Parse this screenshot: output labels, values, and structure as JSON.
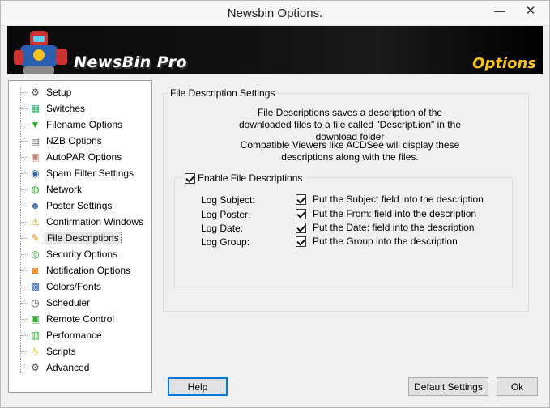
{
  "window": {
    "title": "Newsbin Options.",
    "minimize_glyph": "—",
    "close_glyph": "✕"
  },
  "banner": {
    "brand": "NewsBin Pro",
    "tag": "Options"
  },
  "sidebar": {
    "items": [
      {
        "label": "Setup",
        "icon": "gear-icon",
        "glyph": "⚙",
        "color": "#555"
      },
      {
        "label": "Switches",
        "icon": "switches-icon",
        "glyph": "▦",
        "color": "#2a6"
      },
      {
        "label": "Filename Options",
        "icon": "download-icon",
        "glyph": "▼",
        "color": "#2a2"
      },
      {
        "label": "NZB Options",
        "icon": "nzb-icon",
        "glyph": "▤",
        "color": "#666"
      },
      {
        "label": "AutoPAR Options",
        "icon": "autopar-icon",
        "glyph": "▣",
        "color": "#b87"
      },
      {
        "label": "Spam Filter Settings",
        "icon": "spam-filter-icon",
        "glyph": "◉",
        "color": "#369"
      },
      {
        "label": "Network",
        "icon": "network-icon",
        "glyph": "◍",
        "color": "#3a3"
      },
      {
        "label": "Poster Settings",
        "icon": "poster-icon",
        "glyph": "☻",
        "color": "#46a"
      },
      {
        "label": "Confirmation Windows",
        "icon": "warning-icon",
        "glyph": "⚠",
        "color": "#d9a400"
      },
      {
        "label": "File Descriptions",
        "icon": "file-descriptions-icon",
        "glyph": "✎",
        "color": "#c80"
      },
      {
        "label": "Security Options",
        "icon": "security-icon",
        "glyph": "◎",
        "color": "#3a3"
      },
      {
        "label": "Notification Options",
        "icon": "rss-icon",
        "glyph": "◙",
        "color": "#e70"
      },
      {
        "label": "Colors/Fonts",
        "icon": "colors-icon",
        "glyph": "▩",
        "color": "#36a"
      },
      {
        "label": "Scheduler",
        "icon": "clock-icon",
        "glyph": "◷",
        "color": "#555"
      },
      {
        "label": "Remote Control",
        "icon": "remote-control-icon",
        "glyph": "▣",
        "color": "#3a3"
      },
      {
        "label": "Performance",
        "icon": "performance-icon",
        "glyph": "▥",
        "color": "#3a3"
      },
      {
        "label": "Scripts",
        "icon": "lightning-icon",
        "glyph": "ϟ",
        "color": "#e8b800"
      },
      {
        "label": "Advanced",
        "icon": "advanced-gear-icon",
        "glyph": "⚙",
        "color": "#555"
      }
    ],
    "selected": "File Descriptions"
  },
  "content": {
    "section_title": "File Description Settings",
    "description_1": "File Descriptions saves a description of the downloaded files to a file called \"Descript.ion\" in the download folder",
    "description_2": "Compatible Viewers like ACDSee will display these descriptions along with the files.",
    "enable_label": "Enable File Descriptions",
    "enable_checked": true,
    "logs": [
      {
        "label": "Log Subject:",
        "desc": "Put the Subject field into the description",
        "checked": true
      },
      {
        "label": "Log Poster:",
        "desc": "Put the From: field into the description",
        "checked": true
      },
      {
        "label": "Log Date:",
        "desc": "Put the Date: field into the description",
        "checked": true
      },
      {
        "label": "Log Group:",
        "desc": "Put the Group into the description",
        "checked": true
      }
    ]
  },
  "buttons": {
    "help": "Help",
    "default_settings": "Default Settings",
    "ok": "Ok"
  },
  "colors": {
    "accent": "#0078d7",
    "brand_yellow": "#f7c21b"
  }
}
